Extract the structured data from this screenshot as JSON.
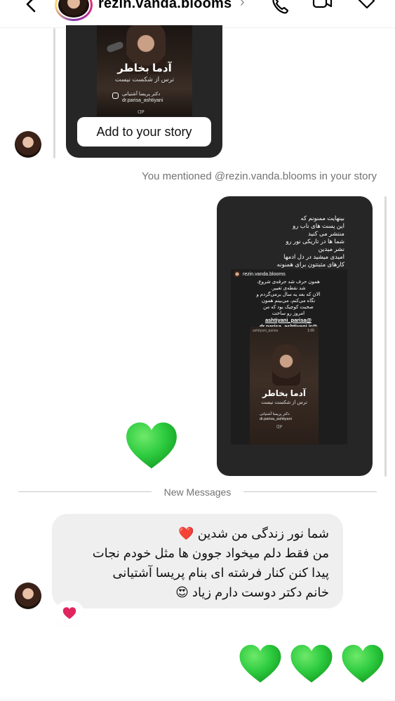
{
  "header": {
    "username": "rezin.vanda.blooms",
    "chevron": "›",
    "icons": [
      "back-arrow-icon",
      "phone-icon",
      "video-icon",
      "tag-icon"
    ]
  },
  "shared_story": {
    "overlay_title": "آدما بخاطر",
    "overlay_subtitle": "ترس از شکست نیست",
    "overlay_credit": "دکتر پریسا آشتیانی\ndr.parisa_ashtiyani",
    "logo_text": "ᗡ𝖯",
    "add_button_label": "Add to your story"
  },
  "system_note": "You mentioned @rezin.vanda.blooms in your story",
  "big_story": {
    "text": "بینهایت ممنونم که\nاین پست های ناب رو\nمنتشر می کنید\nشما ها در تاریکی نور رو\nنشر میدین\nامیدی میشید در دل ادمها\nکارهای مثبتتون برای همنونه\nدوستتون دارم 💚",
    "inner_username": "rezin.vanda.blooms",
    "inner_text": "همون حرف شد جرقه‌ی شروع،\nشد نقطه‌ی تغییر.\nالان که بعد یه سال برمی‌گردم و\nنگاه می‌کنم، می‌بینم همون\nصحبت کوچیک بود که من\nامروز رو ساخت",
    "tag_1": "@ashtiyani_parisa",
    "tag_2": "@dr.parisa_ashtiyani.ir",
    "inner_emoji": "🙏😍",
    "photo_caption": "ashtiyani_parisa",
    "photo_time": "1:05",
    "photo_title": "آدما بخاطر",
    "photo_subtitle": "ترس از شکست نیست",
    "photo_credit": "دکتر پریسا آشتیانی\ndr.parisa_ashtiyani",
    "logo_text": "ᗡ𝖯"
  },
  "divider_label": "New Messages",
  "received_message": {
    "text": "شما نور زندگی من شدین ❤️\nمن فقط دلم میخواد جوون ها مثل خودم نجات\nپیدا کنن کنار فرشته ای بنام پریسا آشتیانی\nخانم دکتر دوست دارم زیاد 😍",
    "reaction": "❤️"
  },
  "colors": {
    "green_heart": "#2ecc40",
    "red_heart": "#e0245e",
    "bubble_bg": "#efefef",
    "story_bg": "#262626",
    "muted_text": "#737373"
  }
}
